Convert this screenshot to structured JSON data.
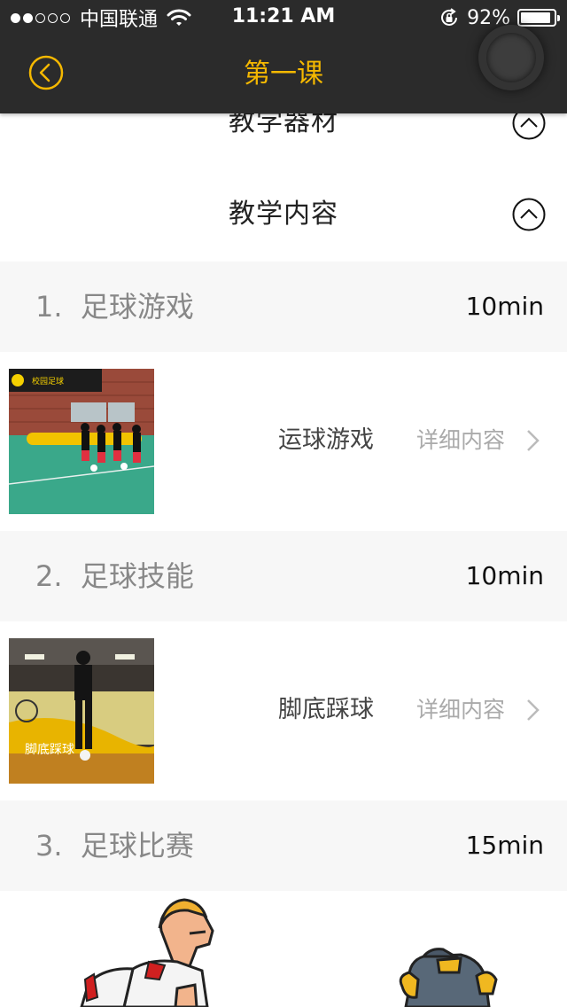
{
  "status_bar": {
    "carrier": "中国联通",
    "time": "11:21 AM",
    "battery_percent": "92%",
    "battery_level": 0.92
  },
  "nav": {
    "title": "第一课",
    "accent_color": "#f5b800"
  },
  "sections": {
    "equipment": "教学器材",
    "content": "教学内容"
  },
  "modules": [
    {
      "number": "1.",
      "title": "足球游戏",
      "duration": "10min",
      "item": "运球游戏",
      "detail": "详细内容"
    },
    {
      "number": "2.",
      "title": "足球技能",
      "duration": "10min",
      "item": "脚底踩球",
      "detail": "详细内容"
    },
    {
      "number": "3.",
      "title": "足球比赛",
      "duration": "15min"
    }
  ],
  "thumbnail_text": {
    "banner_1": "校园足球",
    "caption_2": "脚底踩球"
  }
}
